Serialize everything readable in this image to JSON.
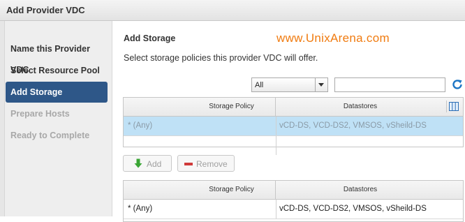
{
  "window": {
    "title": "Add Provider VDC"
  },
  "steps": [
    {
      "label": "Name this Provider VDC",
      "state": "done"
    },
    {
      "label": "Select Resource Pool",
      "state": "done"
    },
    {
      "label": "Add Storage",
      "state": "active"
    },
    {
      "label": "Prepare Hosts",
      "state": "disabled"
    },
    {
      "label": "Ready to Complete",
      "state": "disabled"
    }
  ],
  "main": {
    "heading": "Add Storage",
    "watermark": "www.UnixArena.com",
    "description": "Select storage policies this provider VDC will offer."
  },
  "filter": {
    "selected": "All",
    "search_value": "",
    "refresh_icon": "refresh-icon"
  },
  "available_table": {
    "columns": [
      "Storage Policy",
      "Datastores"
    ],
    "column_chooser_icon": "columns-icon",
    "rows": [
      {
        "policy": "* (Any)",
        "datastores": "vCD-DS, VCD-DS2, VMSOS, vSheild-DS",
        "selected": true
      }
    ]
  },
  "actions": {
    "add_label": "Add",
    "remove_label": "Remove",
    "add_icon": "arrow-down-icon",
    "remove_icon": "minus-icon"
  },
  "selected_table": {
    "columns": [
      "Storage Policy",
      "Datastores"
    ],
    "rows": [
      {
        "policy": "* (Any)",
        "datastores": "vCD-DS, VCD-DS2, VMSOS, vSheild-DS"
      }
    ]
  },
  "colors": {
    "active_step_bg": "#2e5788",
    "selected_row_bg": "#bfe1f6",
    "watermark": "#f07b10",
    "refresh": "#1a74c4",
    "add_icon": "#3aa635",
    "remove_icon": "#d03a3a"
  }
}
